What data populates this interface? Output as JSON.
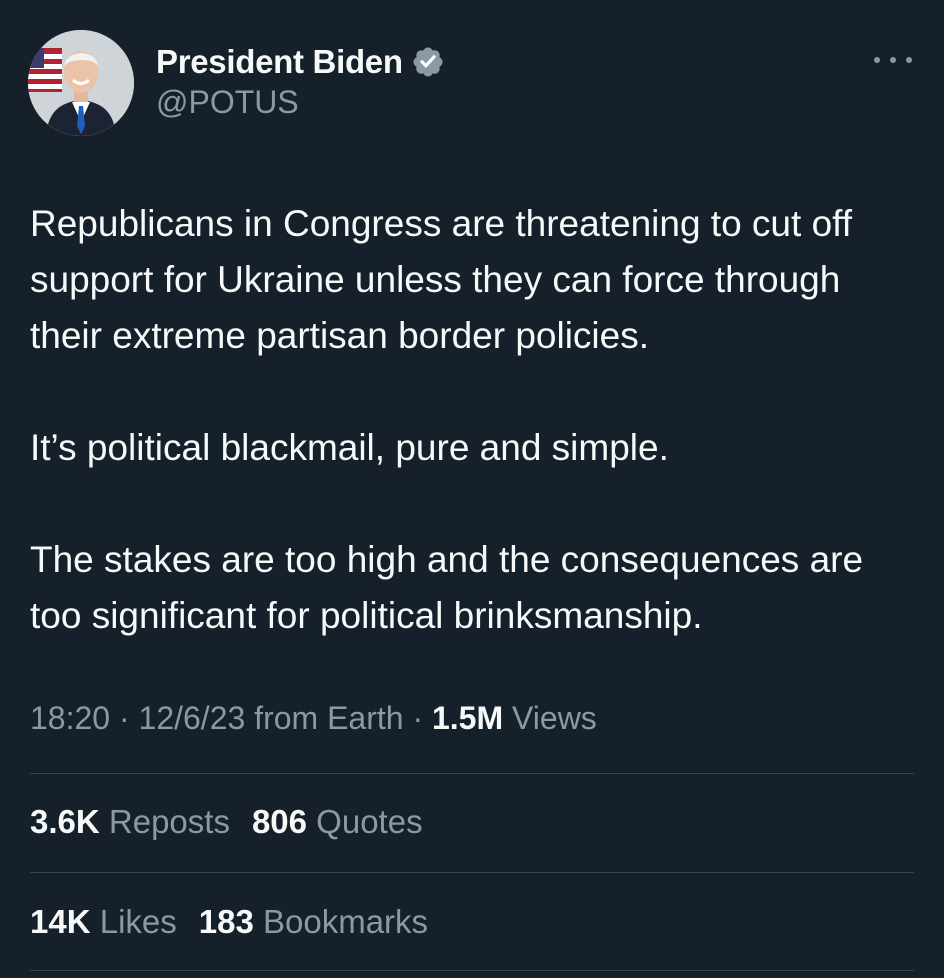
{
  "author": {
    "display_name": "President Biden",
    "handle": "@POTUS",
    "verified": true,
    "avatar_icon": "portrait-avatar",
    "badge_color": "#8b98a5"
  },
  "menu": {
    "more_icon": "ellipsis-icon"
  },
  "tweet": {
    "paragraphs": [
      "Republicans in Congress are threatening to cut off support for Ukraine unless they can force through their extreme partisan border policies.",
      "It’s political blackmail, pure and simple.",
      "The stakes are too high and the consequences are too significant for political brinksmanship."
    ]
  },
  "meta": {
    "time": "18:20",
    "sep1": " · ",
    "date": "12/6/23",
    "source": " from Earth",
    "sep2": " · ",
    "views_count": "1.5M",
    "views_label": " Views"
  },
  "stats_row1": {
    "reposts_count": "3.6K",
    "reposts_label": " Reposts",
    "quotes_count": "806",
    "quotes_label": " Quotes"
  },
  "stats_row2": {
    "likes_count": "14K",
    "likes_label": " Likes",
    "bookmarks_count": "183",
    "bookmarks_label": " Bookmarks"
  },
  "colors": {
    "background": "#15202b",
    "primary_text": "#f7f9f9",
    "secondary_text": "#8b98a5",
    "divider": "#38444d"
  }
}
